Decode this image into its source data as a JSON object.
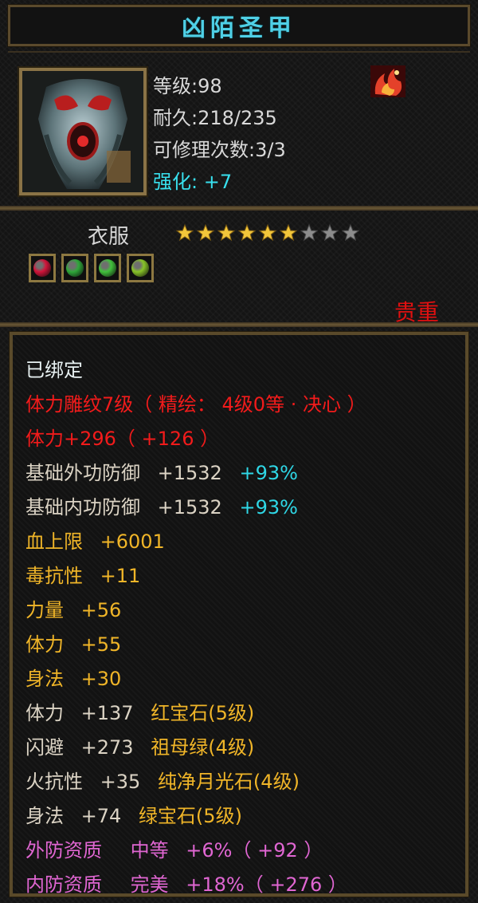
{
  "item": {
    "name": "凶陌圣甲",
    "level": "等级:98",
    "durability": "耐久:218/235",
    "repairs": "可修理次数:3/3",
    "enhance_label": "强化:",
    "enhance_value": "+7",
    "type": "衣服",
    "rarity": "贵重",
    "stars": {
      "filled": 6,
      "total": 9
    },
    "gem_slots": [
      {
        "icon": "red-gem-icon",
        "color": "#d2143a"
      },
      {
        "icon": "green-gem-icon",
        "color": "#2fa83a"
      },
      {
        "icon": "green-leaf-gem-icon",
        "color": "#41c13c"
      },
      {
        "icon": "green-crystal-gem-icon",
        "color": "#88c428"
      }
    ]
  },
  "attributes": {
    "bound": "已绑定",
    "engrave": "体力雕纹7级（ 精绘： 4级0等 · 决心 ）",
    "engrave_stat": "体力+296（ +126 ）",
    "base_ext_def_label": "基础外功防御",
    "base_ext_def_value": "+1532",
    "base_ext_def_pct": "+93%",
    "base_int_def_label": "基础内功防御",
    "base_int_def_value": "+1532",
    "base_int_def_pct": "+93%",
    "hp_max_label": "血上限",
    "hp_max_value": "+6001",
    "poison_res_label": "毒抗性",
    "poison_res_value": "+11",
    "strength_label": "力量",
    "strength_value": "+56",
    "stamina_label": "体力",
    "stamina_value": "+55",
    "agility_label": "身法",
    "agility_value": "+30",
    "gems": [
      {
        "stat": "体力",
        "value": "+137",
        "gem": "红宝石(5级)"
      },
      {
        "stat": "闪避",
        "value": "+273",
        "gem": "祖母绿(4级)"
      },
      {
        "stat": "火抗性",
        "value": "+35",
        "gem": "纯净月光石(4级)"
      },
      {
        "stat": "身法",
        "value": "+74",
        "gem": "绿宝石(5级)"
      }
    ],
    "ext_quality_label": "外防资质",
    "ext_quality_grade": "中等",
    "ext_quality_value": "+6%（ +92 ）",
    "int_quality_label": "内防资质",
    "int_quality_grade": "完美",
    "int_quality_value": "+18%（ +276 ）"
  },
  "colors": {
    "title": "#4fd0e6",
    "enhance": "#38e0ee",
    "rarity": "#e01010",
    "red_attr": "#f21b1b",
    "yellow_attr": "#f0b528",
    "cyan_pct": "#2fd7e6",
    "pink_quality": "#e066d2",
    "star_gold": "#f2c63a",
    "star_empty": "#8c8c8c"
  }
}
